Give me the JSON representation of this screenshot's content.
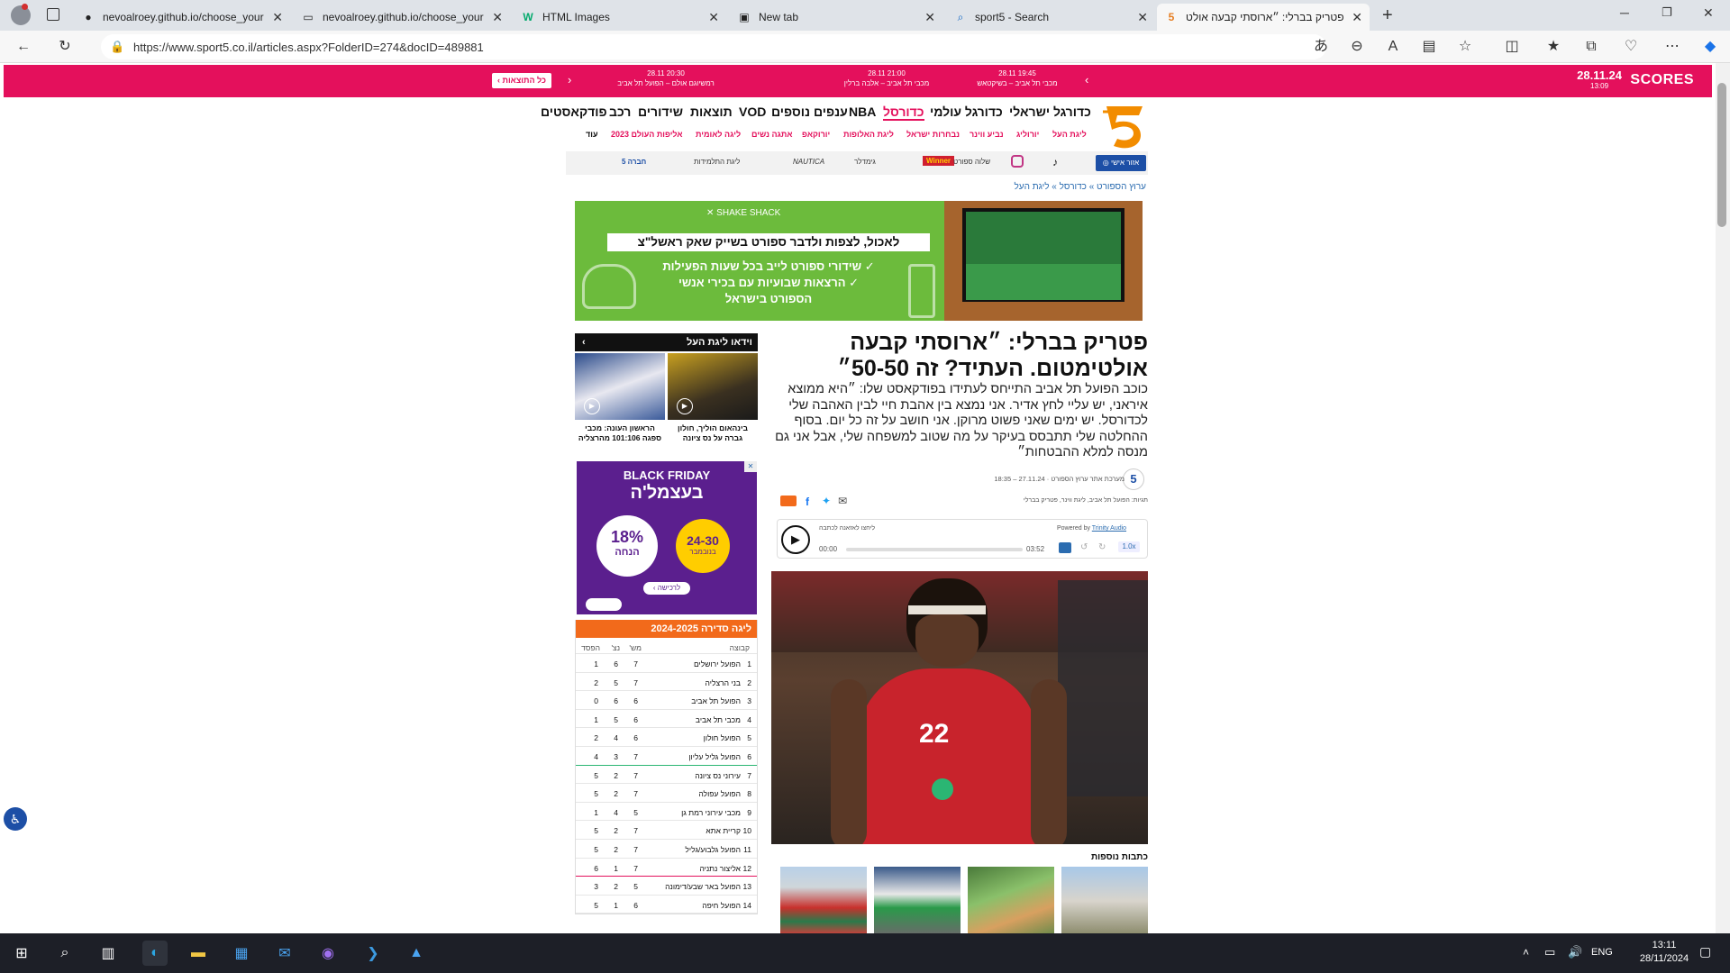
{
  "browser": {
    "tabs": [
      {
        "label": "nevoalroey.github.io/choose_your",
        "icon": "github-icon"
      },
      {
        "label": "nevoalroey.github.io/choose_your",
        "icon": "page-icon"
      },
      {
        "label": "HTML Images",
        "icon": "w3-icon"
      },
      {
        "label": "New tab",
        "icon": "newtab-icon"
      },
      {
        "label": "sport5 - Search",
        "icon": "search-icon"
      },
      {
        "label": "פטריק בברלי: ״ארוסתי קבעה אולט",
        "icon": "sport5-icon"
      }
    ],
    "url": "https://www.sport5.co.il/articles.aspx?FolderID=274&docID=489881"
  },
  "scores": {
    "logo": "SCORES",
    "date": "28.11.24",
    "time": "13:09",
    "all_results": "כל התוצאות",
    "matches": [
      {
        "date": "28.11 19:45",
        "home": "מכבי תל אביב",
        "away": "בשיקטאש"
      },
      {
        "date": "28.11 21:00",
        "home": "מכבי תל אביב",
        "away": "אלבה ברלין"
      },
      {
        "date": "28.11 20:30",
        "home": "רמשיוגם אולם",
        "away": "הפועל תל אביב"
      }
    ]
  },
  "nav": {
    "main": [
      "כדורגל ישראלי",
      "כדורגל עולמי",
      "כדורסל",
      "NBA",
      "ענפים נוספים",
      "VOD",
      "תוצאות",
      "שידורים",
      "רכב",
      "פודקאסטים"
    ],
    "selected": "כדורסל",
    "sub": [
      "ליגת העל",
      "יורוליג",
      "נביע ווינר",
      "נבחרות ישראל",
      "ליגת האלופות",
      "יורוקאפ",
      "אתגה נשים",
      "ליגה לאומית",
      "אליפות העולם 2023",
      "עוד"
    ]
  },
  "partners": {
    "user_login": "אזור אישי",
    "items": [
      "Winner",
      "ווינר",
      "שלוה ספורט",
      "גימדלר",
      "NAUTICA",
      "ליגת התלמידות",
      "5 חברה"
    ]
  },
  "breadcrumb": "ערוץ הספורט » כדורסל » ליגת העל",
  "topad": {
    "brand": "SHAKE SHACK",
    "headline": "לאכול, לצפות ולדבר ספורט בשייק שאק ראשל\"צ",
    "bullets": [
      "שידורי ספורט לייב בכל שעות הפעילות",
      "הרצאות שבועיות עם בכירי אנשי הספורט בישראל"
    ]
  },
  "article": {
    "title": "פטריק בברלי: ״ארוסתי קבעה אולטימטום. העתיד? זה 50-50״",
    "lead": "כוכב הפועל תל אביב התייחס לעתידו בפודקאסט שלו: ״היא ממוצא איראני, יש עליי לחץ אדיר. אני נמצא בין אהבת חיי לבין האהבה שלי לכדורסל. יש ימים שאני פשוט מרוקן. אני חושב על זה כל יום. בסוף ההחלטה שלי תתבסס בעיקר על מה שטוב למשפחה שלי, אבל אני גם מנסה למלא ההבטחות״",
    "byline": "מערכת אתר ערוץ הספורט",
    "date": "27.11.24",
    "time": "18:35",
    "tags": "תגיות: הפועל תל אביב, ליגת ווינר, פטריק בברלי",
    "audio": {
      "listen": "ליחצו לאזאנה לכתבה",
      "powered": "Powered by",
      "provider": "Trinity Audio",
      "start": "00:00",
      "end": "03:52",
      "speed": "1.0x"
    },
    "jersey_number": "22",
    "more_title": "כתבות נוספות"
  },
  "sidebar": {
    "video_head": "וידאו ליגת העל",
    "videos": [
      {
        "caption": "בינהאום הוליך, חולון גברה על נס ציונה"
      },
      {
        "caption": "הראשון העונה: מכבי ספגה 101:106 מהרצליה"
      }
    ],
    "bf_ad": {
      "title": "BLACK FRIDAY",
      "subtitle": "בעצמל'ה",
      "discount": "18%",
      "discount_label": "הנחה",
      "dates": "24-30",
      "month": "בנובמבר",
      "cta": "לרכישה"
    },
    "league": {
      "title": "ליגה סדירה 2024-2025",
      "headers": [
        "קבוצה",
        "מש'",
        "נצ'",
        "הפסד"
      ],
      "rows": [
        [
          "1",
          "הפועל ירושלים",
          "7",
          "6",
          "1"
        ],
        [
          "2",
          "בני הרצליה",
          "7",
          "5",
          "2"
        ],
        [
          "3",
          "הפועל תל אביב",
          "6",
          "6",
          "0"
        ],
        [
          "4",
          "מכבי תל אביב",
          "6",
          "5",
          "1"
        ],
        [
          "5",
          "הפועל חולון",
          "6",
          "4",
          "2"
        ],
        [
          "6",
          "הפועל גליל עליון",
          "7",
          "3",
          "4"
        ],
        [
          "7",
          "עירוני נס ציונה",
          "7",
          "2",
          "5"
        ],
        [
          "8",
          "הפועל עפולה",
          "7",
          "2",
          "5"
        ],
        [
          "9",
          "מכבי עירוני רמת גן",
          "5",
          "4",
          "1"
        ],
        [
          "10",
          "קריית אתא",
          "7",
          "2",
          "5"
        ],
        [
          "11",
          "הפועל גלבוע/גליל",
          "7",
          "2",
          "5"
        ],
        [
          "12",
          "אליצור נתניה",
          "7",
          "1",
          "6"
        ],
        [
          "13",
          "הפועל באר שבע/דימונה",
          "5",
          "2",
          "3"
        ],
        [
          "14",
          "הפועל חיפה",
          "6",
          "1",
          "5"
        ]
      ]
    }
  },
  "taskbar": {
    "lang": "ENG",
    "time": "13:11",
    "date": "28/11/2024"
  },
  "colors": {
    "brand": "#e4105c",
    "league_head": "#f26a1b",
    "chrome": "#dfe3e8"
  }
}
